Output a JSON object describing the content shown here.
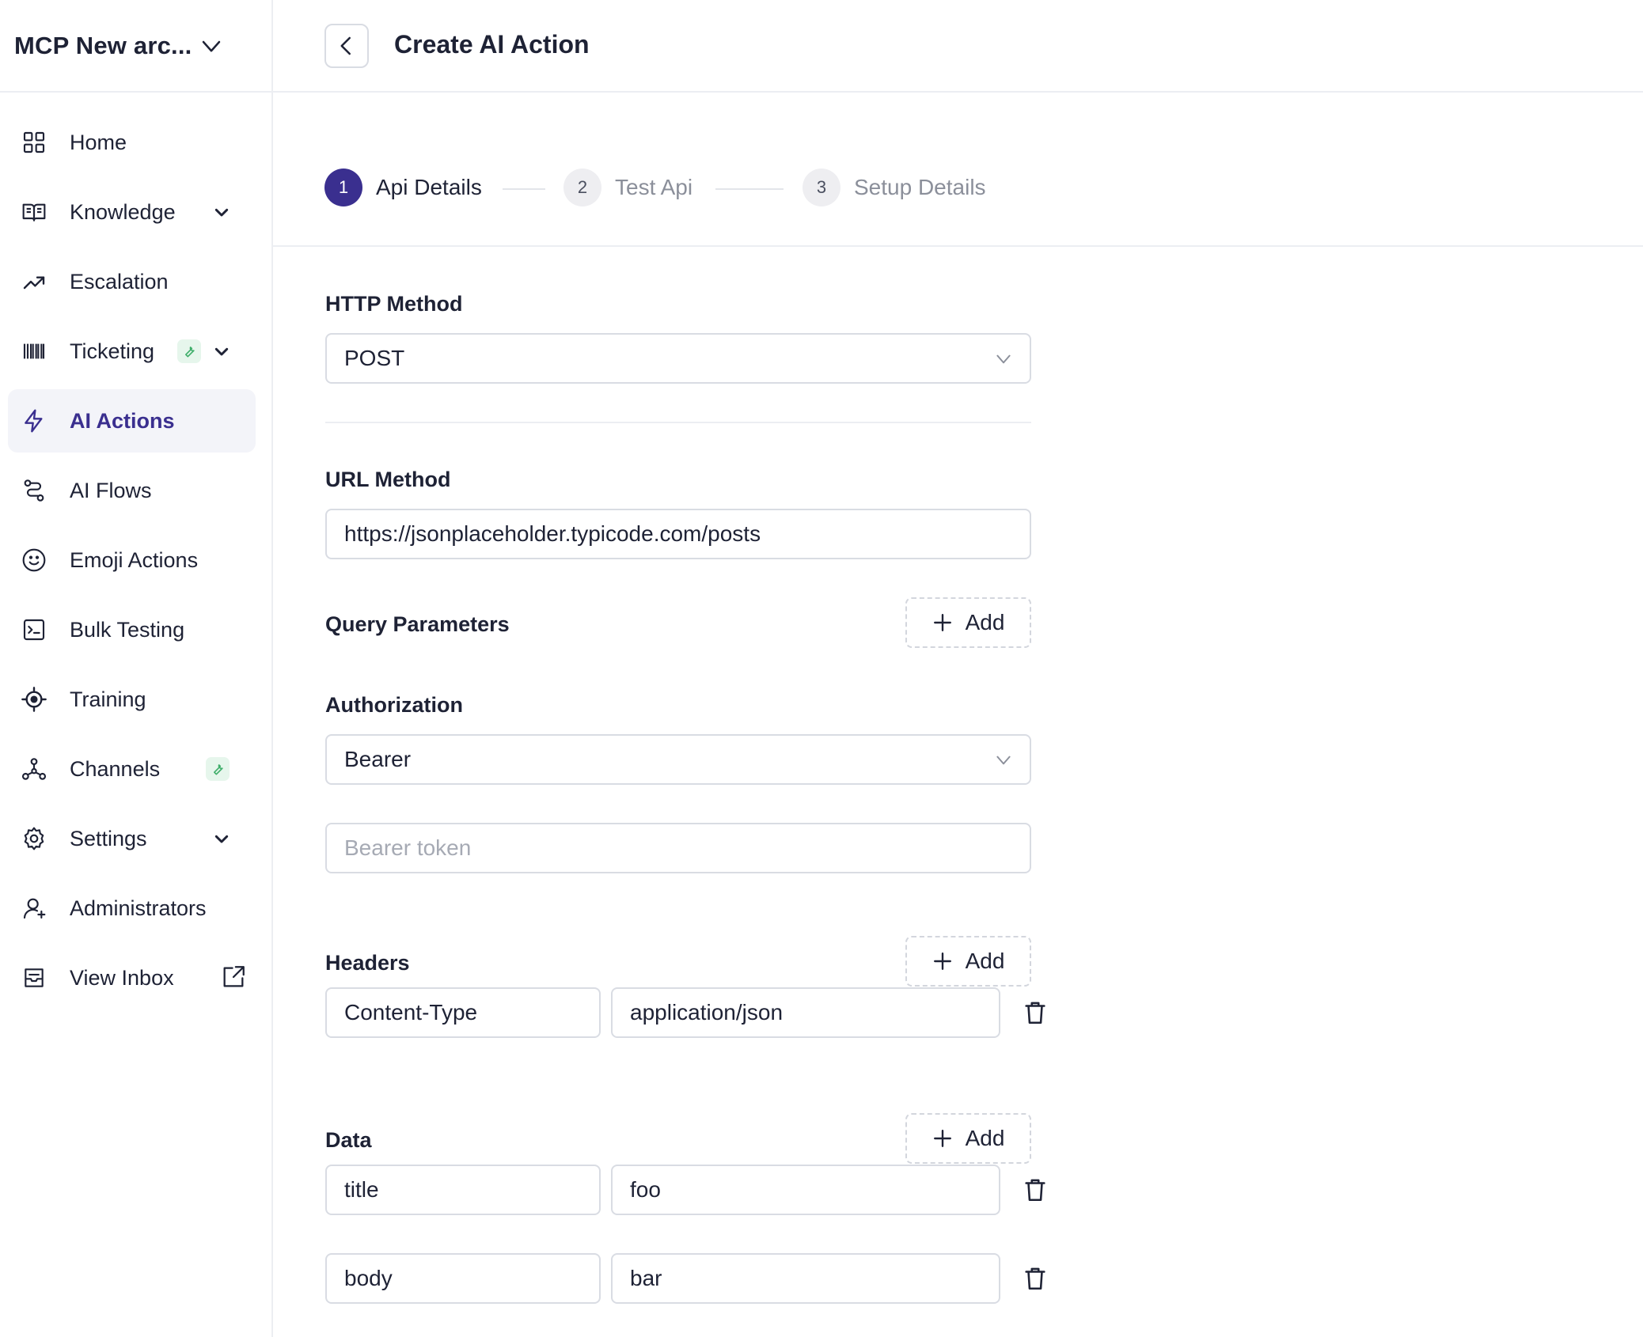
{
  "workspace": {
    "name": "MCP New arc..."
  },
  "nav": [
    {
      "label": "Home",
      "icon": "grid-icon"
    },
    {
      "label": "Knowledge",
      "icon": "book-icon",
      "expandable": true
    },
    {
      "label": "Escalation",
      "icon": "trend-up-icon"
    },
    {
      "label": "Ticketing",
      "icon": "barcode-icon",
      "expandable": true,
      "badge": "wrench-icon"
    },
    {
      "label": "AI Actions",
      "icon": "lightning-icon",
      "active": true
    },
    {
      "label": "AI Flows",
      "icon": "flow-icon"
    },
    {
      "label": "Emoji Actions",
      "icon": "smile-icon"
    },
    {
      "label": "Bulk Testing",
      "icon": "terminal-icon"
    },
    {
      "label": "Training",
      "icon": "target-icon"
    },
    {
      "label": "Channels",
      "icon": "network-icon",
      "badge": "wrench-icon"
    },
    {
      "label": "Settings",
      "icon": "gear-icon",
      "expandable": true
    },
    {
      "label": "Administrators",
      "icon": "user-add-icon"
    },
    {
      "label": "View Inbox",
      "icon": "inbox-icon",
      "external": true
    }
  ],
  "header": {
    "title": "Create AI Action"
  },
  "steps": [
    {
      "num": "1",
      "label": "Api Details",
      "state": "current"
    },
    {
      "num": "2",
      "label": "Test Api",
      "state": "pending"
    },
    {
      "num": "3",
      "label": "Setup Details",
      "state": "pending"
    }
  ],
  "form": {
    "http_method_label": "HTTP Method",
    "http_method_value": "POST",
    "url_label": "URL Method",
    "url_value": "https://jsonplaceholder.typicode.com/posts",
    "query_label": "Query Parameters",
    "auth_label": "Authorization",
    "auth_value": "Bearer",
    "token_placeholder": "Bearer token",
    "headers_label": "Headers",
    "headers": [
      {
        "key": "Content-Type",
        "value": "application/json"
      }
    ],
    "data_label": "Data",
    "data": [
      {
        "key": "title",
        "value": "foo"
      },
      {
        "key": "body",
        "value": "bar"
      }
    ],
    "add_label": "Add"
  },
  "colors": {
    "accent": "#3a2f8f",
    "active_bg": "#f3f4f9",
    "border": "#d9dce3",
    "badge_bg": "#e6f6ec",
    "badge_icon": "#3fae6a"
  }
}
